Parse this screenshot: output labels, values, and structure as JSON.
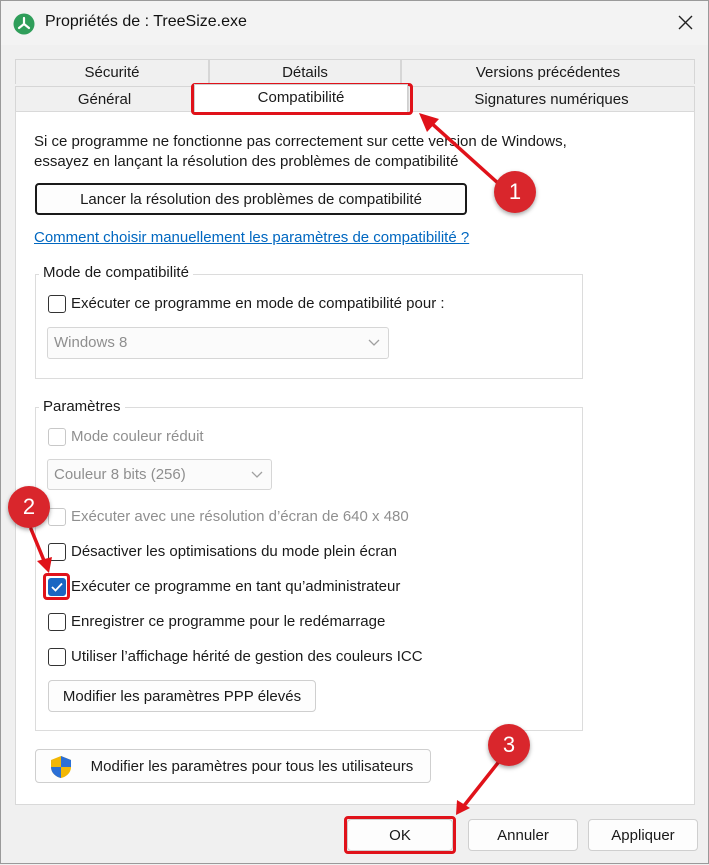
{
  "window": {
    "title": "Propriétés de : TreeSize.exe"
  },
  "tabs": {
    "row1": [
      "Sécurité",
      "Détails",
      "Versions précédentes"
    ],
    "row2": [
      "Général",
      "Compatibilité",
      "Signatures numériques"
    ],
    "active": "Compatibilité"
  },
  "intro": {
    "line1": "Si ce programme ne fonctionne pas correctement sur cette version de Windows,",
    "line2": "essayez en lançant la résolution des problèmes de compatibilité"
  },
  "troubleshoot_button": "Lancer la résolution des problèmes de compatibilité",
  "help_link": "Comment choisir manuellement les paramètres de compatibilité ?",
  "compat_mode": {
    "legend": "Mode de compatibilité",
    "checkbox_label": "Exécuter ce programme en mode de compatibilité pour :",
    "checked": false,
    "selected_os": "Windows 8"
  },
  "settings": {
    "legend": "Paramètres",
    "reduced_color": {
      "label": "Mode couleur réduit",
      "enabled": false,
      "checked": false
    },
    "color_depth": "Couleur 8 bits (256)",
    "resolution_640": {
      "label": "Exécuter avec une résolution d’écran de 640 x 480",
      "enabled": false,
      "checked": false
    },
    "disable_fullscreen_opt": {
      "label": "Désactiver les optimisations du mode plein écran",
      "checked": false
    },
    "run_as_admin": {
      "label": "Exécuter ce programme en tant qu’administrateur",
      "checked": true
    },
    "register_restart": {
      "label": "Enregistrer ce programme pour le redémarrage",
      "checked": false
    },
    "legacy_icc": {
      "label": "Utiliser l’affichage hérité de gestion des couleurs ICC",
      "checked": false
    },
    "dpi_button": "Modifier les paramètres PPP élevés"
  },
  "all_users_button": "Modifier les paramètres pour tous les utilisateurs",
  "footer": {
    "ok": "OK",
    "cancel": "Annuler",
    "apply": "Appliquer"
  },
  "annotations": [
    "1",
    "2",
    "3"
  ],
  "colors": {
    "highlight": "#e0121a",
    "badge": "#d9262c",
    "link": "#0067c0",
    "checkbox_checked": "#1966c2"
  }
}
